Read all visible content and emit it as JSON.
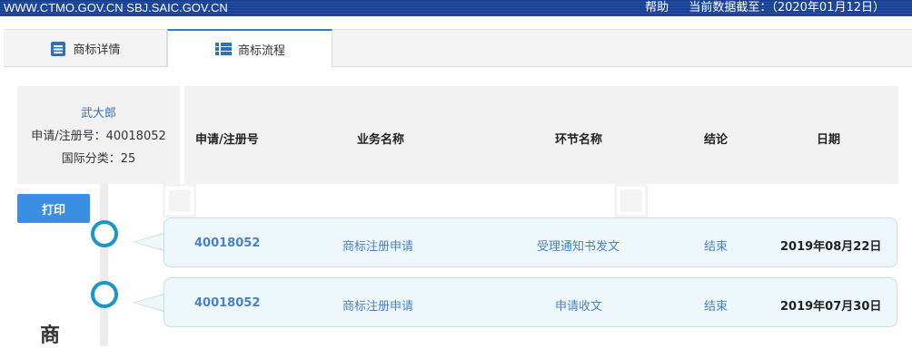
{
  "topbar": {
    "site": "WWW.CTMO.GOV.CN SBJ.SAIC.GOV.CN",
    "help": "帮助",
    "data_date": "当前数据截至：（2020年01月12日）"
  },
  "tabs": [
    {
      "label": "商标详情",
      "icon": "document-icon"
    },
    {
      "label": "商标流程",
      "icon": "list-icon"
    }
  ],
  "info": {
    "owner": "武大郎",
    "reg_no": "申请/注册号：40018052",
    "intl_class": "国际分类：25"
  },
  "table": {
    "headers": [
      "申请/注册号",
      "业务名称",
      "环节名称",
      "结论",
      "日期"
    ],
    "rows": [
      {
        "reg_no": "40018052",
        "business": "商标注册申请",
        "step": "受理通知书发文",
        "result": "结束",
        "date": "2019年08月22日"
      },
      {
        "reg_no": "40018052",
        "business": "商标注册申请",
        "step": "申请收文",
        "result": "结束",
        "date": "2019年07月30日"
      }
    ]
  },
  "print_label": "打印",
  "stamp_char": "商",
  "colors": {
    "accent": "#3a8fe4",
    "timeline": "#1b96c7",
    "link": "#4a82c4"
  }
}
